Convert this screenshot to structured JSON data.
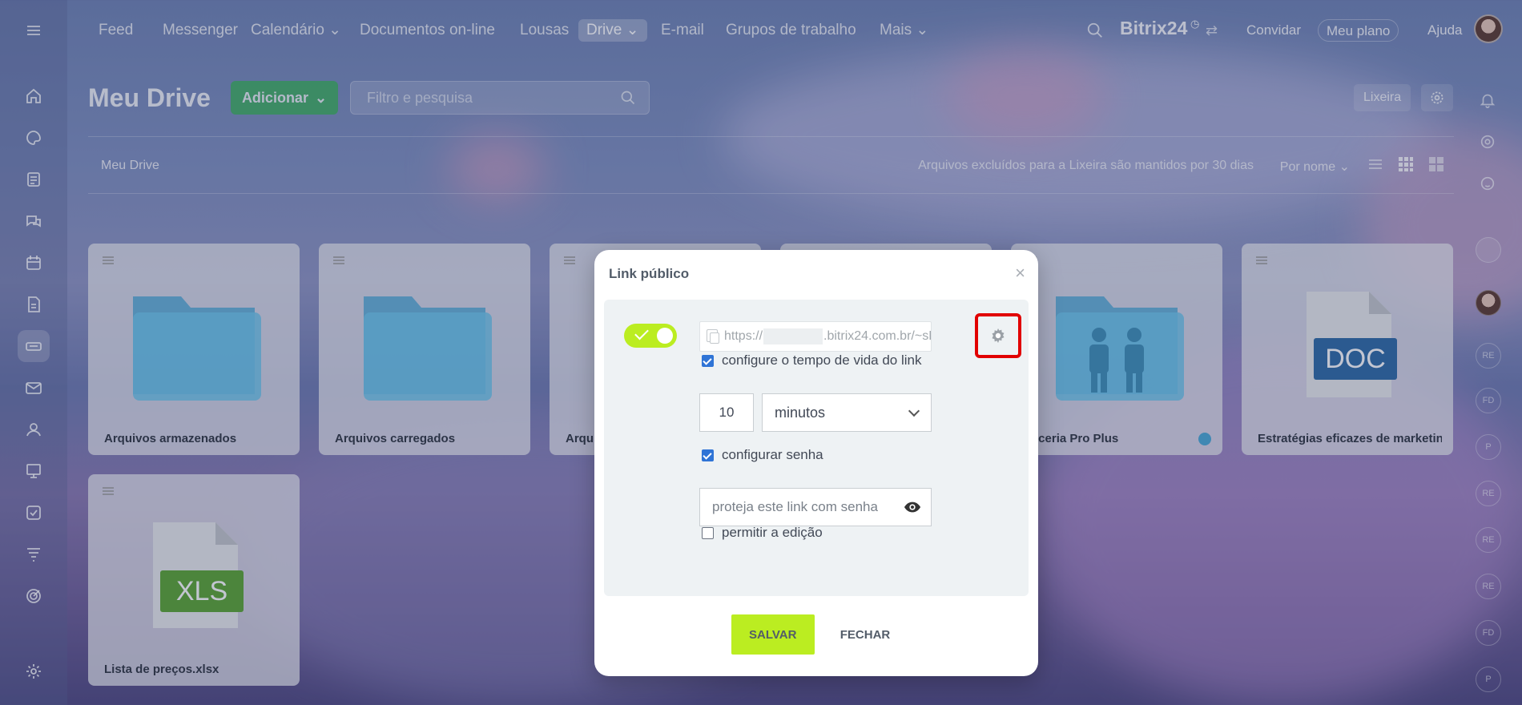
{
  "topnav": {
    "items": [
      "Feed",
      "Messenger",
      "Calendário",
      "Documentos on-line",
      "Lousas",
      "Drive",
      "E-mail",
      "Grupos de trabalho",
      "Mais"
    ],
    "brand": "Bitrix24",
    "invite": "Convidar",
    "plan": "Meu plano",
    "help": "Ajuda"
  },
  "page": {
    "title": "Meu Drive",
    "add_label": "Adicionar",
    "search_placeholder": "Filtro e pesquisa",
    "trash_label": "Lixeira",
    "breadcrumb": "Meu Drive",
    "retention_note": "Arquivos excluídos para a Lixeira são mantidos por 30 dias",
    "sort_label": "Por nome"
  },
  "files": [
    {
      "name": "Arquivos armazenados",
      "kind": "folder"
    },
    {
      "name": "Arquivos carregados",
      "kind": "folder"
    },
    {
      "name": "Arqu",
      "kind": "folder"
    },
    {
      "name": "",
      "kind": "folder"
    },
    {
      "name": "arceria Pro Plus",
      "kind": "shared-folder"
    },
    {
      "name": "Estratégias eficazes de marketin...",
      "kind": "doc",
      "badge": "DOC"
    },
    {
      "name": "Lista de preços.xlsx",
      "kind": "xls",
      "badge": "XLS"
    }
  ],
  "modal": {
    "title": "Link público",
    "url_prefix": "https://",
    "url_suffix": ".bitrix24.com.br/~sE...",
    "lifetime_label": "configure o tempo de vida do link",
    "lifetime_value": "10",
    "lifetime_unit": "minutos",
    "password_label": "configurar senha",
    "password_placeholder": "proteja este link com senha",
    "edit_label": "permitir a edição",
    "save": "SALVAR",
    "close": "FECHAR"
  },
  "rail_bubbles": [
    "RE",
    "FD",
    "P",
    "RE",
    "RE",
    "RE",
    "FD",
    "P"
  ],
  "colors": {
    "accent_green": "#bbed21",
    "add_button": "#3bb55a",
    "highlight_red": "#e10000",
    "folder_blue": "#5fc0e6"
  }
}
